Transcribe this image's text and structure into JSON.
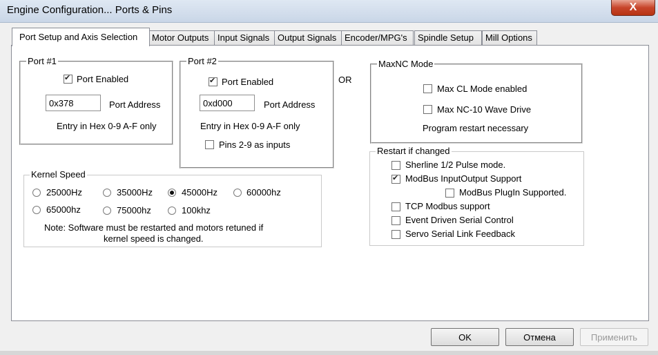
{
  "window": {
    "title": "Engine Configuration... Ports & Pins",
    "close_label": "X"
  },
  "tabs": [
    "Port Setup and Axis Selection",
    "Motor Outputs",
    "Input Signals",
    "Output Signals",
    "Encoder/MPG's",
    "Spindle Setup",
    "Mill Options"
  ],
  "port1": {
    "legend": "Port #1",
    "enabled_label": "Port Enabled",
    "enabled": true,
    "address_value": "0x378",
    "address_label": "Port Address",
    "hint": "Entry in Hex 0-9 A-F only"
  },
  "port2": {
    "legend": "Port #2",
    "enabled_label": "Port Enabled",
    "enabled": true,
    "address_value": "0xd000",
    "address_label": "Port Address",
    "hint": "Entry in Hex 0-9 A-F only",
    "pins_label": "Pins 2-9 as inputs",
    "pins_checked": false
  },
  "or_label": "OR",
  "maxnc": {
    "legend": "MaxNC Mode",
    "opt1": "Max CL Mode enabled",
    "opt2": "Max NC-10 Wave Drive",
    "note": "Program restart necessary"
  },
  "kernel": {
    "legend": "Kernel Speed",
    "options": [
      "25000Hz",
      "35000Hz",
      "45000Hz",
      "60000hz",
      "65000hz",
      "75000hz",
      "100khz"
    ],
    "selected": "45000Hz",
    "note_line1": "Note: Software must be restarted and motors retuned if",
    "note_line2": "kernel speed is changed."
  },
  "restart": {
    "legend": "Restart if changed",
    "sherline": "Sherline 1/2 Pulse mode.",
    "modbus_io": "ModBus InputOutput Support",
    "modbus_plugin": "ModBus PlugIn Supported.",
    "tcp_modbus": "TCP Modbus support",
    "event_serial": "Event Driven Serial Control",
    "servo_serial": "Servo Serial Link Feedback",
    "modbus_io_checked": true
  },
  "buttons": {
    "ok": "OK",
    "cancel": "Отмена",
    "apply": "Применить"
  }
}
